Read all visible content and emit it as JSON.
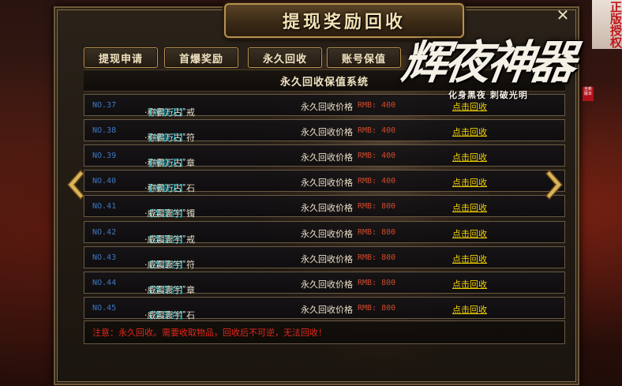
{
  "window": {
    "title": "提现奖励回收",
    "close_symbol": "✕"
  },
  "tabs": [
    {
      "label": "提现申请"
    },
    {
      "label": "首爆奖励"
    },
    {
      "label": "永久回收"
    },
    {
      "label": "账号保值"
    }
  ],
  "section_title": "永久回收保值系统",
  "rows": [
    {
      "no": "NO.37",
      "bracket": "【神宸灭】",
      "name": "·称霸万古˚戒",
      "price_label": "永久回收价格",
      "price": "RMB: 400",
      "action": "点击回收"
    },
    {
      "no": "NO.38",
      "bracket": "【神宸灭】",
      "name": "·称霸万古˚符",
      "price_label": "永久回收价格",
      "price": "RMB: 400",
      "action": "点击回收"
    },
    {
      "no": "NO.39",
      "bracket": "【神宸灭】",
      "name": "·称霸万古˚章",
      "price_label": "永久回收价格",
      "price": "RMB: 400",
      "action": "点击回收"
    },
    {
      "no": "NO.40",
      "bracket": "【神宸灭】",
      "name": "·称霸万古˚石",
      "price_label": "永久回收价格",
      "price": "RMB: 400",
      "action": "点击回收"
    },
    {
      "no": "NO.41",
      "bracket": "【圣昆仑】",
      "name": "·威震寰宇˚镯",
      "price_label": "永久回收价格",
      "price": "RMB: 800",
      "action": "点击回收"
    },
    {
      "no": "NO.42",
      "bracket": "【圣昆仑】",
      "name": "·威震寰宇˚戒",
      "price_label": "永久回收价格",
      "price": "RMB: 800",
      "action": "点击回收"
    },
    {
      "no": "NO.43",
      "bracket": "【圣昆仑】",
      "name": "·威震寰宇˚符",
      "price_label": "永久回收价格",
      "price": "RMB: 800",
      "action": "点击回收"
    },
    {
      "no": "NO.44",
      "bracket": "【圣昆仑】",
      "name": "·威震寰宇˚章",
      "price_label": "永久回收价格",
      "price": "RMB: 800",
      "action": "点击回收"
    },
    {
      "no": "NO.45",
      "bracket": "【圣昆仑】",
      "name": "·威震寰宇˚石",
      "price_label": "永久回收价格",
      "price": "RMB: 800",
      "action": "点击回收"
    }
  ],
  "notice": "注意：永久回收。需要收取物品，回收后不可逆，无法回收！",
  "logo": {
    "title": "辉夜神器",
    "subtitle": "化身黑夜 刺破光明",
    "stamp": "全新版本"
  },
  "corner_badge": "正版授权",
  "icons": {
    "prev": "chevron-left-icon",
    "next": "chevron-right-icon"
  },
  "colors": {
    "accent_gold": "#b8924f",
    "link_yellow": "#f0d000",
    "warning_red": "#e3281a",
    "number_blue": "#3f78c0",
    "bracket_cyan": "#19c4d8",
    "price_red": "#d04a2a"
  }
}
